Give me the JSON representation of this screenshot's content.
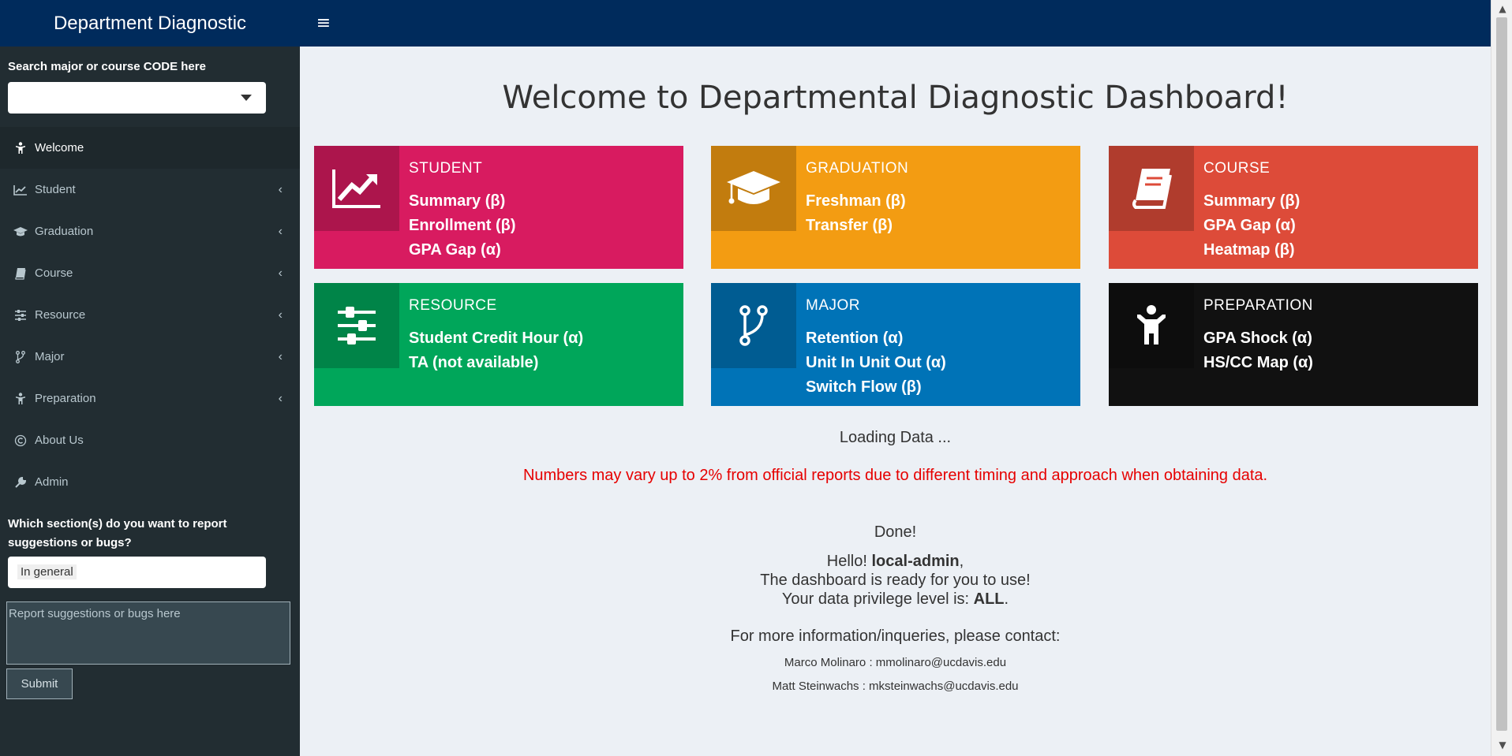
{
  "header": {
    "app_title": "Department Diagnostic",
    "menu_toggle_icon": "hamburger-icon"
  },
  "sidebar": {
    "search_label": "Search major or course CODE here",
    "search_value": "",
    "menu": [
      {
        "label": "Welcome",
        "icon": "child-icon",
        "active": true,
        "expandable": false
      },
      {
        "label": "Student",
        "icon": "line-chart-icon",
        "active": false,
        "expandable": true
      },
      {
        "label": "Graduation",
        "icon": "graduation-cap-icon",
        "active": false,
        "expandable": true
      },
      {
        "label": "Course",
        "icon": "book-icon",
        "active": false,
        "expandable": true
      },
      {
        "label": "Resource",
        "icon": "sliders-icon",
        "active": false,
        "expandable": true
      },
      {
        "label": "Major",
        "icon": "code-fork-icon",
        "active": false,
        "expandable": true
      },
      {
        "label": "Preparation",
        "icon": "child-icon",
        "active": false,
        "expandable": true
      },
      {
        "label": "About Us",
        "icon": "copyright-icon",
        "active": false,
        "expandable": false
      },
      {
        "label": "Admin",
        "icon": "wrench-icon",
        "active": false,
        "expandable": false
      }
    ],
    "report_label": "Which section(s) do you want to report suggestions or bugs?",
    "report_selected": "In general",
    "report_placeholder": "Report suggestions or bugs here",
    "submit_label": "Submit"
  },
  "main": {
    "title": "Welcome to Departmental Diagnostic Dashboard!",
    "cards": [
      {
        "title": "STUDENT",
        "icon": "line-chart-icon",
        "color": "#d81b60",
        "links": [
          "Summary (β)",
          "Enrollment (β)",
          "GPA Gap (α)"
        ]
      },
      {
        "title": "GRADUATION",
        "icon": "graduation-cap-icon",
        "color": "#f39c12",
        "links": [
          "Freshman (β)",
          "Transfer (β)"
        ]
      },
      {
        "title": "COURSE",
        "icon": "book-icon",
        "color": "#dd4b39",
        "links": [
          "Summary (β)",
          "GPA Gap (α)",
          "Heatmap (β)"
        ]
      },
      {
        "title": "RESOURCE",
        "icon": "sliders-icon",
        "color": "#00a65a",
        "links": [
          "Student Credit Hour (α)",
          "TA (not available)"
        ]
      },
      {
        "title": "MAJOR",
        "icon": "code-fork-icon",
        "color": "#0073b7",
        "links": [
          "Retention (α)",
          "Unit In Unit Out (α)",
          "Switch Flow (β)"
        ]
      },
      {
        "title": "PREPARATION",
        "icon": "child-icon",
        "color": "#111111",
        "links": [
          "GPA Shock (α)",
          "HS/CC Map (α)"
        ]
      }
    ],
    "loading": "Loading Data ...",
    "disclaimer": "Numbers may vary up to 2% from official reports due to different timing and approach when obtaining data.",
    "done": "Done!",
    "hello_prefix": "Hello! ",
    "username": "local-admin",
    "hello_suffix": ",",
    "ready": "The dashboard is ready for you to use!",
    "privilege_prefix": "Your data privilege level is: ",
    "privilege": "ALL",
    "privilege_suffix": ".",
    "more_info": "For more information/inqueries, please contact:",
    "contacts": [
      "Marco Molinaro : mmolinaro@ucdavis.edu",
      "Matt Steinwachs : mksteinwachs@ucdavis.edu"
    ]
  }
}
